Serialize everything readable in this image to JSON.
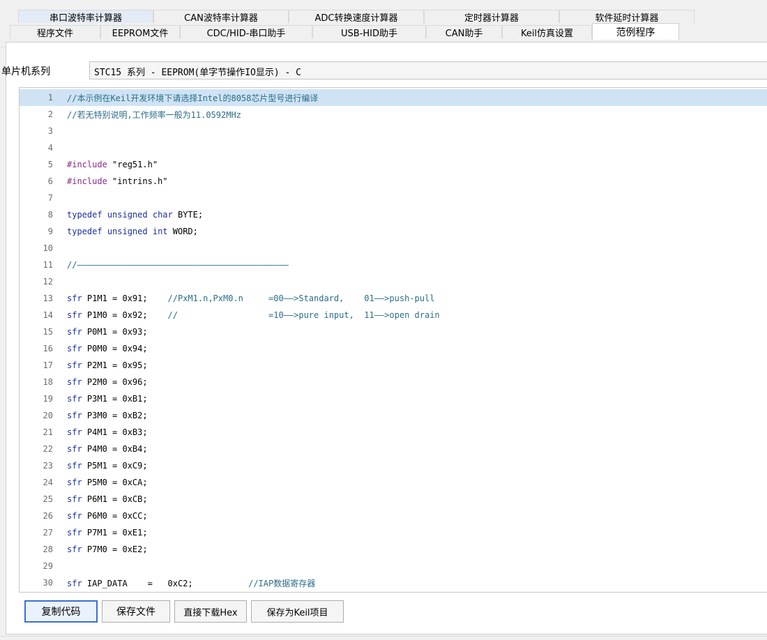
{
  "tabs_row1": [
    {
      "label": "串口波特率计算器",
      "selected": true
    },
    {
      "label": "CAN波特率计算器",
      "selected": false
    },
    {
      "label": "ADC转换速度计算器",
      "selected": false
    },
    {
      "label": "定时器计算器",
      "selected": false
    },
    {
      "label": "软件延时计算器",
      "selected": false
    }
  ],
  "tabs_row2": [
    {
      "label": "程序文件",
      "selected": false
    },
    {
      "label": "EEPROM文件",
      "selected": false
    },
    {
      "label": "CDC/HID-串口助手",
      "selected": false
    },
    {
      "label": "USB-HID助手",
      "selected": false
    },
    {
      "label": "CAN助手",
      "selected": false
    },
    {
      "label": "Keil仿真设置",
      "selected": false
    },
    {
      "label": "范例程序",
      "selected": true
    }
  ],
  "series": {
    "label": "单片机系列",
    "value": "STC15 系列 - EEPROM(单字节操作IO显示) - C"
  },
  "code_lines": [
    {
      "n": "1",
      "text": "//本示例在Keil开发环境下请选择Intel的8058芯片型号进行编译"
    },
    {
      "n": "2",
      "text": "//若无特别说明,工作频率一般为11.0592MHz"
    },
    {
      "n": "3",
      "text": ""
    },
    {
      "n": "4",
      "text": ""
    },
    {
      "n": "5",
      "text": "#include \"reg51.h\""
    },
    {
      "n": "6",
      "text": "#include \"intrins.h\""
    },
    {
      "n": "7",
      "text": ""
    },
    {
      "n": "8",
      "text": "typedef unsigned char BYTE;"
    },
    {
      "n": "9",
      "text": "typedef unsigned int WORD;"
    },
    {
      "n": "10",
      "text": ""
    },
    {
      "n": "11",
      "text": "//——————————————————————————————————————————"
    },
    {
      "n": "12",
      "text": ""
    },
    {
      "n": "13",
      "text": "sfr P1M1 = 0x91;    //PxM1.n,PxM0.n     =00——>Standard,    01——>push-pull"
    },
    {
      "n": "14",
      "text": "sfr P1M0 = 0x92;    //                  =10——>pure input,  11——>open drain"
    },
    {
      "n": "15",
      "text": "sfr P0M1 = 0x93;"
    },
    {
      "n": "16",
      "text": "sfr P0M0 = 0x94;"
    },
    {
      "n": "17",
      "text": "sfr P2M1 = 0x95;"
    },
    {
      "n": "18",
      "text": "sfr P2M0 = 0x96;"
    },
    {
      "n": "19",
      "text": "sfr P3M1 = 0xB1;"
    },
    {
      "n": "20",
      "text": "sfr P3M0 = 0xB2;"
    },
    {
      "n": "21",
      "text": "sfr P4M1 = 0xB3;"
    },
    {
      "n": "22",
      "text": "sfr P4M0 = 0xB4;"
    },
    {
      "n": "23",
      "text": "sfr P5M1 = 0xC9;"
    },
    {
      "n": "24",
      "text": "sfr P5M0 = 0xCA;"
    },
    {
      "n": "25",
      "text": "sfr P6M1 = 0xCB;"
    },
    {
      "n": "26",
      "text": "sfr P6M0 = 0xCC;"
    },
    {
      "n": "27",
      "text": "sfr P7M1 = 0xE1;"
    },
    {
      "n": "28",
      "text": "sfr P7M0 = 0xE2;"
    },
    {
      "n": "29",
      "text": ""
    },
    {
      "n": "30",
      "text": "sfr IAP_DATA    =   0xC2;           //IAP数据寄存器"
    }
  ],
  "highlighted_line": "1",
  "buttons": {
    "copy": "复制代码",
    "save": "保存文件",
    "download": "直接下载Hex",
    "save_keil": "保存为Keil项目"
  },
  "colors": {
    "highlight": "#cfe3f5",
    "keyword": "#1b2fa4",
    "preprocessor": "#8a2a8a",
    "comment": "#2b6d88",
    "button_focus_border": "#3b6fd1"
  }
}
